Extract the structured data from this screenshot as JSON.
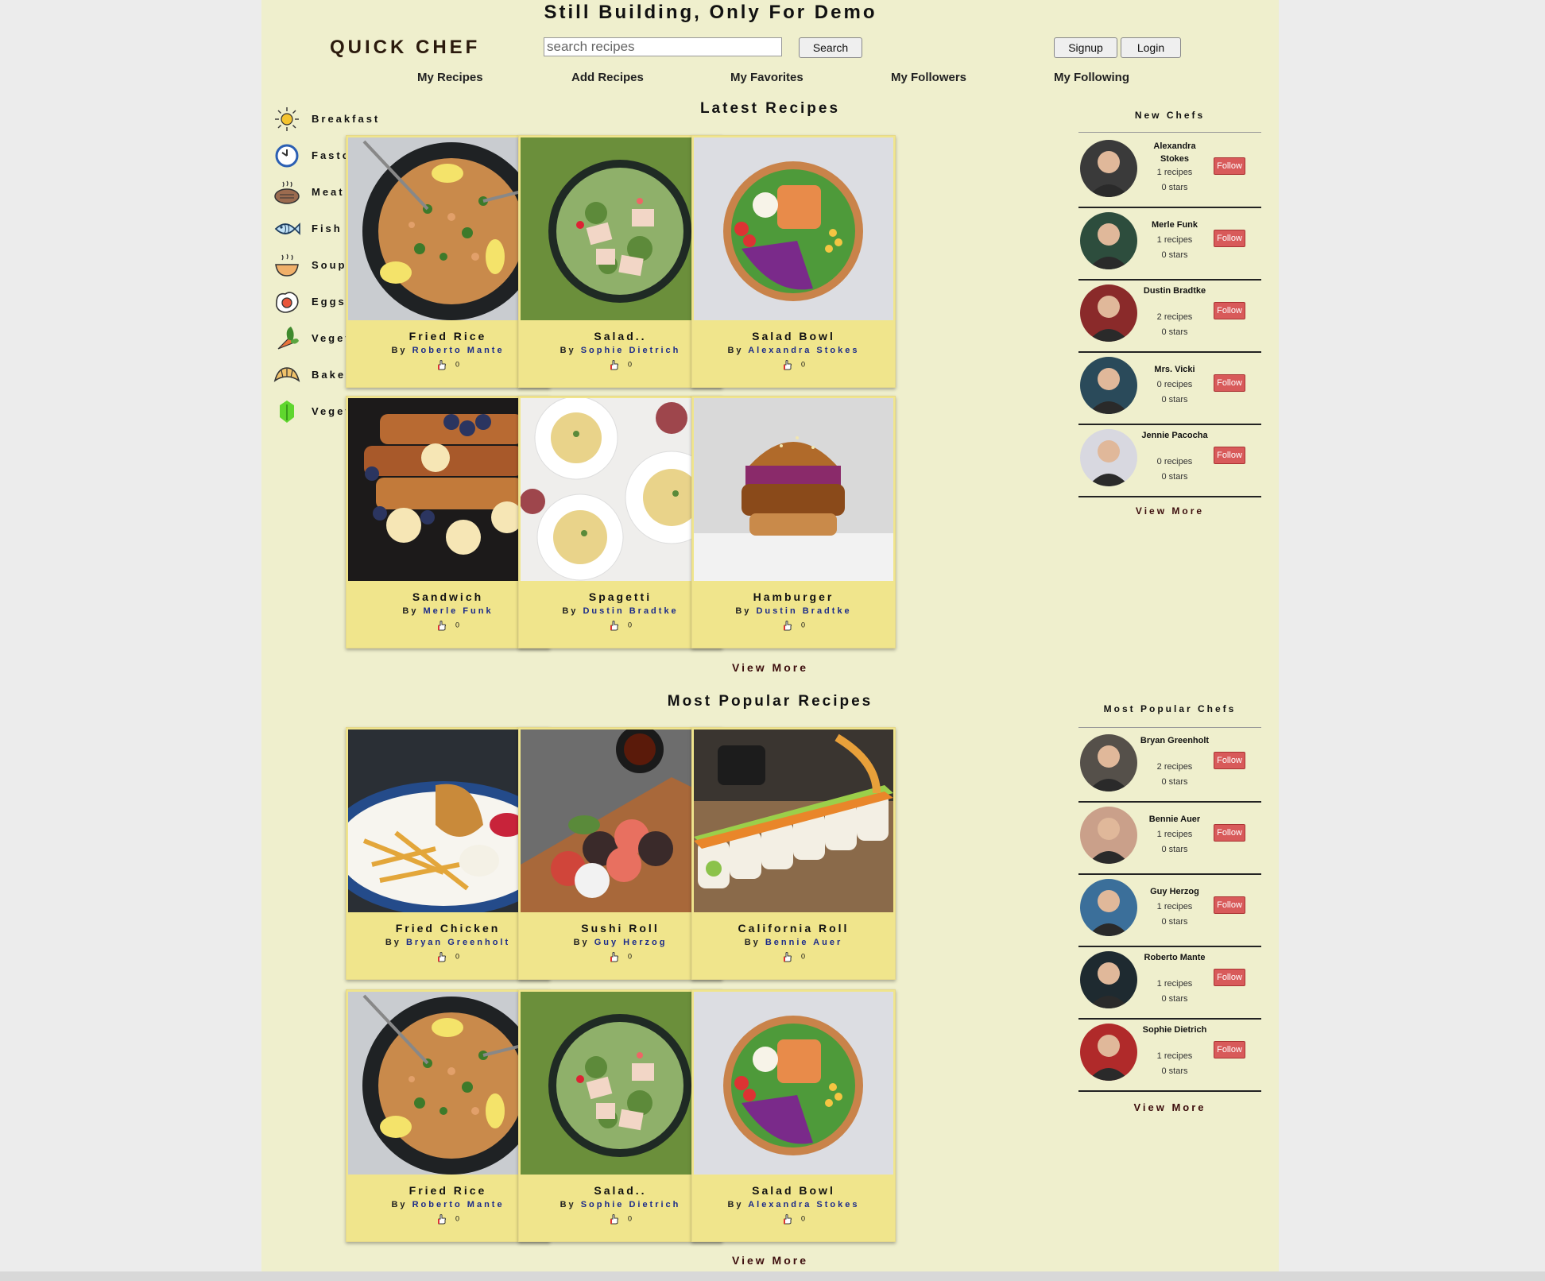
{
  "banner": "Still Building, Only For Demo",
  "logo": "QUICK CHEF",
  "search": {
    "placeholder": "search recipes",
    "button": "Search"
  },
  "auth": {
    "signup": "Signup",
    "login": "Login"
  },
  "nav": [
    "My Recipes",
    "Add Recipes",
    "My Favorites",
    "My Followers",
    "My Following"
  ],
  "categories": [
    {
      "label": "Breakfast",
      "icon": "sun-icon"
    },
    {
      "label": "Fastcook",
      "icon": "clock-icon"
    },
    {
      "label": "Meat",
      "icon": "steak-icon"
    },
    {
      "label": "Fish",
      "icon": "fish-icon"
    },
    {
      "label": "Soup",
      "icon": "soup-bowl-icon"
    },
    {
      "label": "Eggs",
      "icon": "egg-icon"
    },
    {
      "label": "Vegetables",
      "icon": "vegetables-icon"
    },
    {
      "label": "Bakery",
      "icon": "croissant-icon"
    },
    {
      "label": "Vegetarian",
      "icon": "leaf-icon"
    }
  ],
  "latest": {
    "title": "Latest Recipes",
    "view_more": "View More",
    "recipes": [
      {
        "title": "Fried Rice",
        "by": "By",
        "author": "Roberto Mante",
        "likes": "0",
        "image": "fried-rice"
      },
      {
        "title": "Salad..",
        "by": "By",
        "author": "Sophie Dietrich",
        "likes": "0",
        "image": "salad"
      },
      {
        "title": "Salad Bowl",
        "by": "By",
        "author": "Alexandra Stokes",
        "likes": "0",
        "image": "salad-bowl"
      },
      {
        "title": "Sandwich",
        "by": "By",
        "author": "Merle Funk",
        "likes": "0",
        "image": "french-toast"
      },
      {
        "title": "Spagetti",
        "by": "By",
        "author": "Dustin Bradtke",
        "likes": "0",
        "image": "spaghetti"
      },
      {
        "title": "Hamburger",
        "by": "By",
        "author": "Dustin Bradtke",
        "likes": "0",
        "image": "hamburger"
      }
    ]
  },
  "popular": {
    "title": "Most Popular Recipes",
    "view_more": "View More",
    "recipes": [
      {
        "title": "Fried Chicken",
        "by": "By",
        "author": "Bryan Greenholt",
        "likes": "0",
        "image": "fried-chicken"
      },
      {
        "title": "Sushi Roll",
        "by": "By",
        "author": "Guy Herzog",
        "likes": "0",
        "image": "sushi"
      },
      {
        "title": "California Roll",
        "by": "By",
        "author": "Bennie Auer",
        "likes": "0",
        "image": "california-roll"
      },
      {
        "title": "Fried Rice",
        "by": "By",
        "author": "Roberto Mante",
        "likes": "0",
        "image": "fried-rice"
      },
      {
        "title": "Salad..",
        "by": "By",
        "author": "Sophie Dietrich",
        "likes": "0",
        "image": "salad"
      },
      {
        "title": "Salad Bowl",
        "by": "By",
        "author": "Alexandra Stokes",
        "likes": "0",
        "image": "salad-bowl"
      }
    ]
  },
  "new_chefs": {
    "title": "New Chefs",
    "view_more": "View More",
    "chefs": [
      {
        "name": "Alexandra Stokes",
        "recipes": "1 recipes",
        "stars": "0 stars",
        "follow": "Follow"
      },
      {
        "name": "Merle Funk",
        "recipes": "1 recipes",
        "stars": "0 stars",
        "follow": "Follow"
      },
      {
        "name": "Dustin Bradtke",
        "recipes": "2 recipes",
        "stars": "0 stars",
        "follow": "Follow"
      },
      {
        "name": "Mrs. Vicki",
        "recipes": "0 recipes",
        "stars": "0 stars",
        "follow": "Follow"
      },
      {
        "name": "Jennie Pacocha",
        "recipes": "0 recipes",
        "stars": "0 stars",
        "follow": "Follow"
      }
    ]
  },
  "popular_chefs": {
    "title": "Most Popular Chefs",
    "view_more": "View More",
    "chefs": [
      {
        "name": "Bryan Greenholt",
        "recipes": "2 recipes",
        "stars": "0 stars",
        "follow": "Follow"
      },
      {
        "name": "Bennie Auer",
        "recipes": "1 recipes",
        "stars": "0 stars",
        "follow": "Follow"
      },
      {
        "name": "Guy Herzog",
        "recipes": "1 recipes",
        "stars": "0 stars",
        "follow": "Follow"
      },
      {
        "name": "Roberto Mante",
        "recipes": "1 recipes",
        "stars": "0 stars",
        "follow": "Follow"
      },
      {
        "name": "Sophie Dietrich",
        "recipes": "1 recipes",
        "stars": "0 stars",
        "follow": "Follow"
      }
    ]
  }
}
